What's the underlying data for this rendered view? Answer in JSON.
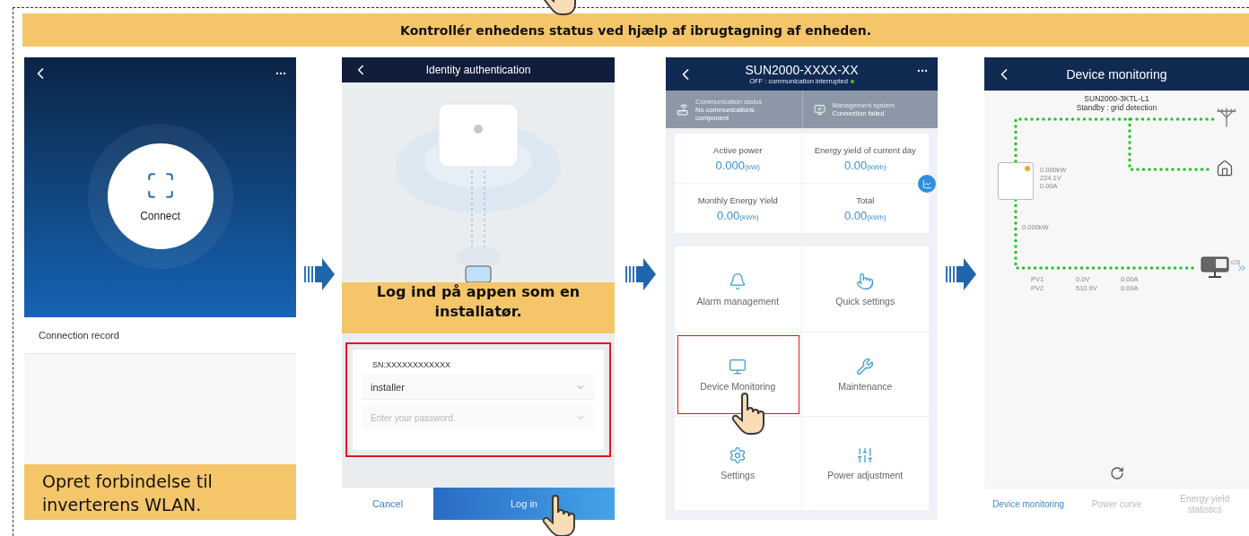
{
  "banner": "Kontrollér enhedens status ved hjælp af ibrugtagning af enheden.",
  "connect_screen": {
    "connect_label": "Connect",
    "list_items": [
      "Connection record"
    ],
    "caption": "Opret forbindelse til inverterens WLAN."
  },
  "login_screen": {
    "title": "Identity authentication",
    "caption": "Log ind på appen som en installatør.",
    "serial": "SN:XXXXXXXXXXXX",
    "user_field": {
      "value": "installer"
    },
    "password_field": {
      "placeholder": "Enter your password."
    },
    "buttons": [
      {
        "label": "Cancel",
        "kind": "text"
      },
      {
        "label": "Log in",
        "kind": "primary"
      }
    ]
  },
  "home_screen": {
    "title": "SUN2000-XXXX-XX",
    "subtitle": "OFF : communication interrupted",
    "status_items": [
      {
        "label": "Communication status",
        "value": "No communications component"
      },
      {
        "label": "Management system",
        "value": "Connection failed"
      }
    ],
    "stats": [
      {
        "label": "Active power",
        "value": "0.000",
        "unit": "(kW)"
      },
      {
        "label": "Energy yield of current day",
        "value": "0.00",
        "unit": "(kWh)"
      },
      {
        "label": "Monthly Energy Yield",
        "value": "0.00",
        "unit": "(kWh)"
      },
      {
        "label": "Total",
        "value": "0.00",
        "unit": "(kWh)"
      }
    ],
    "menu": [
      {
        "label": "Alarm management",
        "selected": false
      },
      {
        "label": "Quick settings",
        "selected": false
      },
      {
        "label": "Device Monitoring",
        "selected": true
      },
      {
        "label": "Maintenance",
        "selected": false
      },
      {
        "label": "Settings",
        "selected": false
      },
      {
        "label": "Power adjustment",
        "selected": false
      }
    ]
  },
  "monitoring_screen": {
    "title": "Device monitoring",
    "device": "SUN2000-3KTL-L1",
    "status": "Standby : grid detection",
    "inverter_readings": [
      "0.000kW",
      "224.1V",
      "0.00A"
    ],
    "pv_power": "0.000kW",
    "pv_count": "x26",
    "pv_rows": [
      [
        "PV1",
        "0.0V",
        "0.00A"
      ],
      [
        "PV2",
        "510.9V",
        "0.00A"
      ]
    ],
    "tabs": [
      {
        "label": "Device monitoring",
        "selected": true
      },
      {
        "label": "Power curve",
        "selected": false
      },
      {
        "label": "Energy yield statistics",
        "selected": false
      }
    ]
  }
}
